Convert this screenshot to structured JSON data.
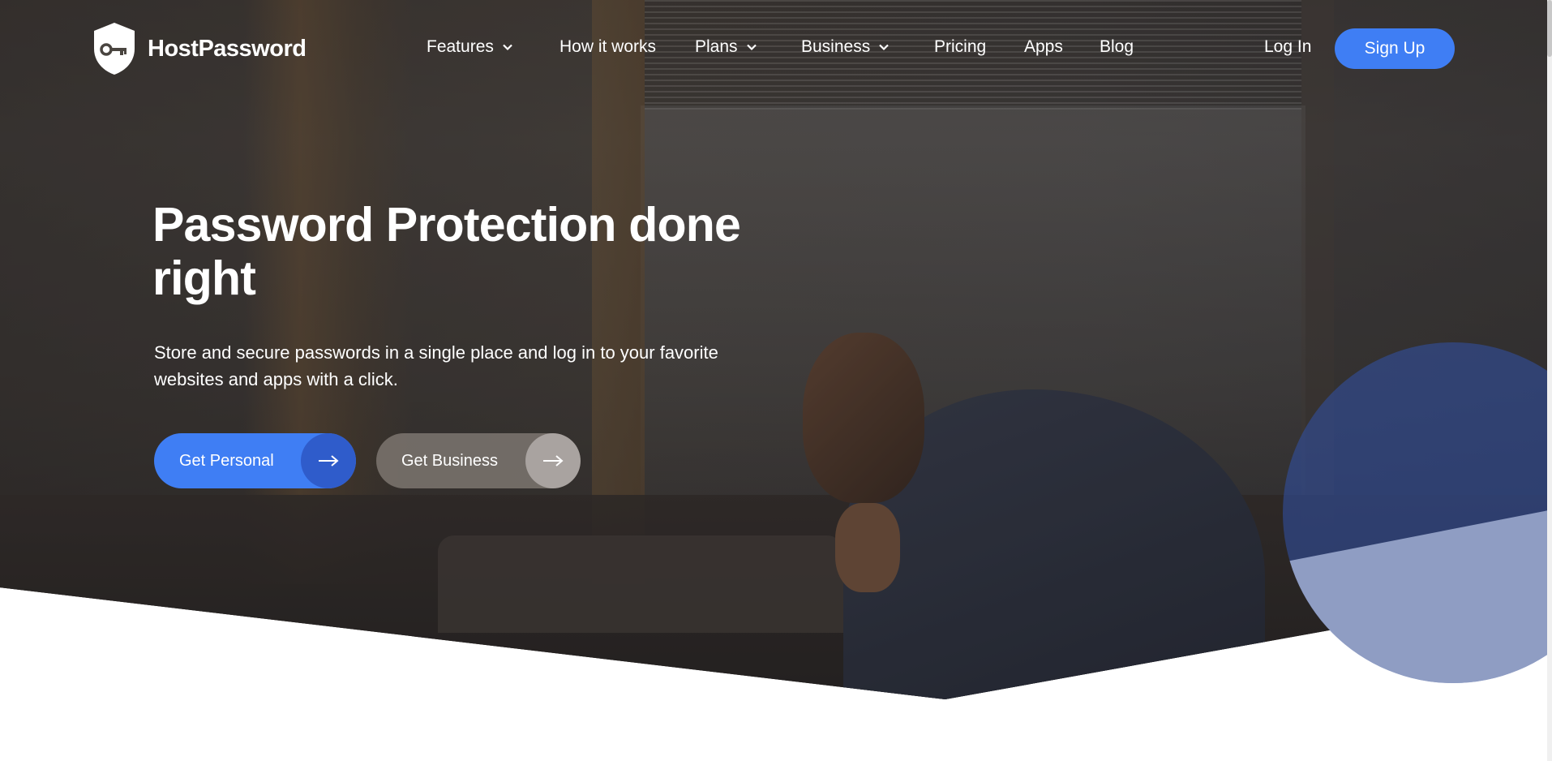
{
  "brand": {
    "name": "HostPassword"
  },
  "nav": {
    "items": [
      {
        "label": "Features",
        "has_dropdown": true
      },
      {
        "label": "How it works",
        "has_dropdown": false
      },
      {
        "label": "Plans",
        "has_dropdown": true
      },
      {
        "label": "Business",
        "has_dropdown": true
      },
      {
        "label": "Pricing",
        "has_dropdown": false
      },
      {
        "label": "Apps",
        "has_dropdown": false
      },
      {
        "label": "Blog",
        "has_dropdown": false
      }
    ],
    "login_label": "Log In",
    "signup_label": "Sign Up"
  },
  "hero": {
    "headline": "Password Protection done right",
    "subheadline": "Store and secure passwords in a single place and log in to your favorite websites and apps with a click.",
    "buttons": {
      "personal_label": "Get Personal",
      "business_label": "Get Business"
    }
  },
  "colors": {
    "accent": "#3f7ef4",
    "accent_dark": "#2f5ccb",
    "text_on_dark": "#ffffff",
    "page_bg": "#ffffff"
  },
  "icons": {
    "logo": "shield-key-icon",
    "dropdown": "chevron-down-icon",
    "cta": "arrow-right-icon"
  }
}
